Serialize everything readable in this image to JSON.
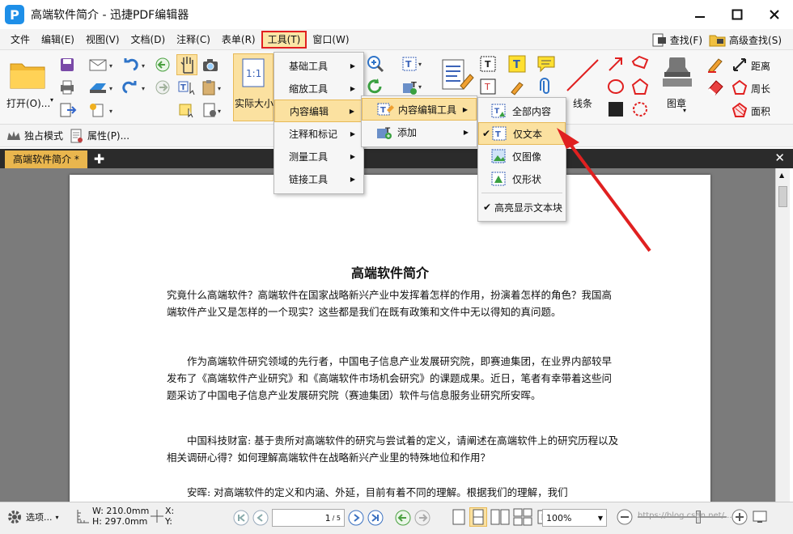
{
  "window": {
    "title": "高端软件简介 - 迅捷PDF编辑器"
  },
  "menubar": {
    "items": [
      "文件",
      "编辑(E)",
      "视图(V)",
      "文档(D)",
      "注释(C)",
      "表单(R)",
      "工具(T)",
      "窗口(W)"
    ],
    "find_label": "查找(F)",
    "adv_find_label": "高级查找(S)"
  },
  "ribbon": {
    "open_label": "打开(O)...",
    "actual_size_label": "实际大小",
    "line_label": "线条",
    "stamp_label": "图章",
    "distance_label": "距离",
    "perimeter_label": "周长",
    "area_label": "面积"
  },
  "subbar": {
    "exclusive_mode": "独占模式",
    "properties": "属性(P)..."
  },
  "tab": {
    "doc_label": "高端软件简介 *"
  },
  "menus": {
    "tools": {
      "items": [
        "基础工具",
        "缩放工具",
        "内容编辑",
        "注释和标记",
        "测量工具",
        "链接工具"
      ]
    },
    "content_edit": {
      "items": [
        "内容编辑工具",
        "添加"
      ]
    },
    "edit_tool": {
      "items": [
        "全部内容",
        "仅文本",
        "仅图像",
        "仅形状"
      ],
      "highlight_label": "高亮显示文本块"
    }
  },
  "document": {
    "title": "高端软件简介",
    "p1": "究竟什么高端软件？高端软件在国家战略新兴产业中发挥着怎样的作用，扮演着怎样的角色？我国高端软件产业又是怎样的一个现实？这些都是我们在既有政策和文件中无以得知的真问题。",
    "p2": "作为高端软件研究领域的先行者，中国电子信息产业发展研究院，即赛迪集团，在业界内部较早发布了《高端软件产业研究》和《高端软件市场机会研究》的课题成果。近日，笔者有幸带着这些问题采访了中国电子信息产业发展研究院（赛迪集团）软件与信息服务业研究所安晖。",
    "p3": "中国科技财富: 基于贵所对高端软件的研究与尝试着的定义，请阐述在高端软件上的研究历程以及相关调研心得？如何理解高端软件在战略新兴产业里的特殊地位和作用？",
    "p4": "安晖: 对高端软件的定义和内涵、外延，目前有着不同的理解。根据我们的理解，我们"
  },
  "status": {
    "options_label": "选项...",
    "width_label": "W: 210.0mm",
    "height_label": "H: 297.0mm",
    "x_label": "X:",
    "y_label": "Y:",
    "page_current": "1",
    "page_total": "/ 5",
    "zoom": "100%",
    "watermark": "https://blog.csdn.net/..."
  }
}
